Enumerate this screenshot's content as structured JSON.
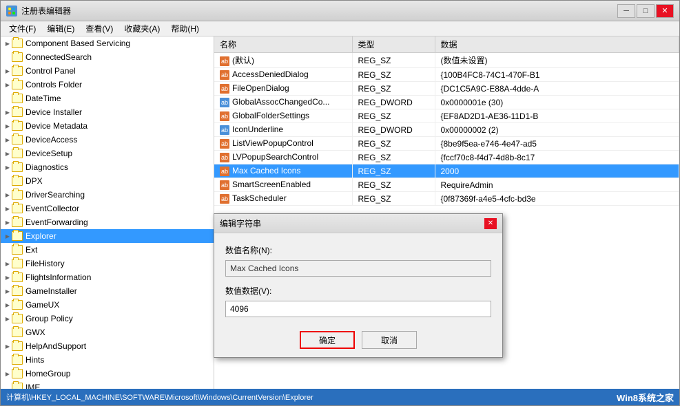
{
  "window": {
    "title": "注册表编辑器",
    "icon": "reg-editor-icon"
  },
  "titleControls": {
    "minimize": "─",
    "maximize": "□",
    "close": "✕"
  },
  "menuBar": {
    "items": [
      {
        "label": "文件(F)"
      },
      {
        "label": "编辑(E)"
      },
      {
        "label": "查看(V)"
      },
      {
        "label": "收藏夹(A)"
      },
      {
        "label": "帮助(H)"
      }
    ]
  },
  "treePanel": {
    "items": [
      {
        "label": "Component Based Servicing",
        "indent": 1,
        "hasArrow": true
      },
      {
        "label": "ConnectedSearch",
        "indent": 1
      },
      {
        "label": "Control Panel",
        "indent": 1
      },
      {
        "label": "Controls Folder",
        "indent": 1
      },
      {
        "label": "DateTime",
        "indent": 1
      },
      {
        "label": "Device Installer",
        "indent": 1
      },
      {
        "label": "Device Metadata",
        "indent": 1
      },
      {
        "label": "DeviceAccess",
        "indent": 1
      },
      {
        "label": "DeviceSetup",
        "indent": 1
      },
      {
        "label": "Diagnostics",
        "indent": 1
      },
      {
        "label": "DPX",
        "indent": 1
      },
      {
        "label": "DriverSearching",
        "indent": 1
      },
      {
        "label": "EventCollector",
        "indent": 1
      },
      {
        "label": "EventForwarding",
        "indent": 1
      },
      {
        "label": "Explorer",
        "indent": 1,
        "selected": true
      },
      {
        "label": "Ext",
        "indent": 1
      },
      {
        "label": "FileHistory",
        "indent": 1
      },
      {
        "label": "FlightsInformation",
        "indent": 1
      },
      {
        "label": "GameInstaller",
        "indent": 1
      },
      {
        "label": "GameUX",
        "indent": 1
      },
      {
        "label": "Group Policy",
        "indent": 1
      },
      {
        "label": "GWX",
        "indent": 1
      },
      {
        "label": "HelpAndSupport",
        "indent": 1
      },
      {
        "label": "Hints",
        "indent": 1
      },
      {
        "label": "HomeGroup",
        "indent": 1
      },
      {
        "label": "IME",
        "indent": 1
      }
    ]
  },
  "registryTable": {
    "columns": [
      "名称",
      "类型",
      "数据"
    ],
    "rows": [
      {
        "name": "(默认)",
        "type": "REG_SZ",
        "data": "(数值未设置)",
        "icon": "ab"
      },
      {
        "name": "AccessDeniedDialog",
        "type": "REG_SZ",
        "data": "{100B4FC8-74C1-470F-B1",
        "icon": "ab"
      },
      {
        "name": "FileOpenDialog",
        "type": "REG_SZ",
        "data": "{DC1C5A9C-E88A-4dde-A",
        "icon": "ab"
      },
      {
        "name": "GlobalAssocChangedCo...",
        "type": "REG_DWORD",
        "data": "0x0000001e (30)",
        "icon": "dword"
      },
      {
        "name": "GlobalFolderSettings",
        "type": "REG_SZ",
        "data": "{EF8AD2D1-AE36-11D1-B",
        "icon": "ab"
      },
      {
        "name": "IconUnderline",
        "type": "REG_DWORD",
        "data": "0x00000002 (2)",
        "icon": "dword"
      },
      {
        "name": "ListViewPopupControl",
        "type": "REG_SZ",
        "data": "{8be9f5ea-e746-4e47-ad5",
        "icon": "ab"
      },
      {
        "name": "LVPopupSearchControl",
        "type": "REG_SZ",
        "data": "{fccf70c8-f4d7-4d8b-8c17",
        "icon": "ab"
      },
      {
        "name": "Max Cached Icons",
        "type": "REG_SZ",
        "data": "2000",
        "icon": "ab",
        "selected": true
      },
      {
        "name": "SmartScreenEnabled",
        "type": "REG_SZ",
        "data": "RequireAdmin",
        "icon": "ab"
      },
      {
        "name": "TaskScheduler",
        "type": "REG_SZ",
        "data": "{0f87369f-a4e5-4cfc-bd3e",
        "icon": "ab"
      }
    ]
  },
  "dialog": {
    "title": "编辑字符串",
    "nameLabel": "数值名称(N):",
    "nameValue": "Max Cached Icons",
    "dataLabel": "数值数据(V):",
    "dataValue": "4096",
    "okLabel": "确定",
    "cancelLabel": "取消"
  },
  "statusBar": {
    "path": "计算机\\HKEY_LOCAL_MACHINE\\SOFTWARE\\Microsoft\\Windows\\CurrentVersion\\Explorer",
    "logo": "Win8系统之家"
  }
}
